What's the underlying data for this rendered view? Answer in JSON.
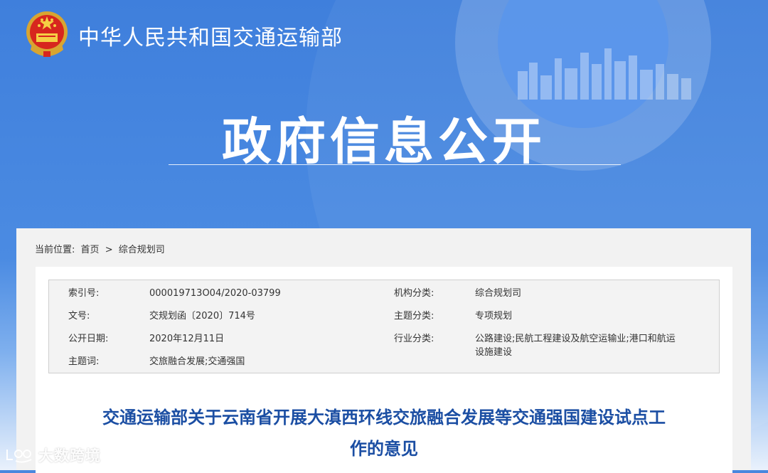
{
  "header": {
    "ministry_name": "中华人民共和国交通运输部",
    "page_heading": "政府信息公开"
  },
  "breadcrumb": {
    "prefix": "当前位置:",
    "home": "首页",
    "separator": ">",
    "current": "综合规划司"
  },
  "metadata": {
    "index_label": "索引号:",
    "index_value": "000019713O04/2020-03799",
    "doc_no_label": "文号:",
    "doc_no_value": "交规划函〔2020〕714号",
    "date_label": "公开日期:",
    "date_value": "2020年12月11日",
    "keywords_label": "主题词:",
    "keywords_value": "交旅融合发展;交通强国",
    "org_label": "机构分类:",
    "org_value": "综合规划司",
    "topic_label": "主题分类:",
    "topic_value": "专项规划",
    "industry_label": "行业分类:",
    "industry_value_line1": "公路建设;民航工程建设及航空运输业;港口和航运",
    "industry_value_line2": "设施建设"
  },
  "article": {
    "title_line1": "交通运输部关于云南省开展大滇西环线交旅融合发展等交通强国建设试点工",
    "title_line2": "作的意见"
  },
  "watermark": {
    "text": "大数跨境"
  }
}
